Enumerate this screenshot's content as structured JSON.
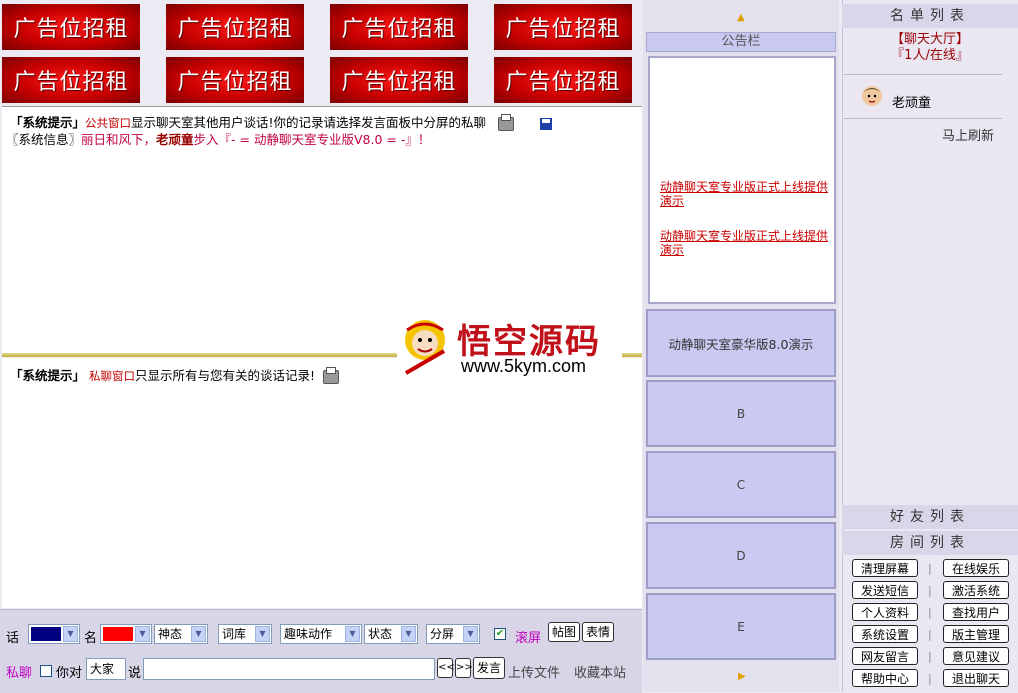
{
  "ads": {
    "label": "广告位招租",
    "count": 8
  },
  "public_window": {
    "line1": {
      "tag": "「系统提示」",
      "window": "公共窗口",
      "text": "显示聊天室其他用户谈话!你的记录请选择发言面板中分屏的私聊"
    },
    "line2": {
      "tag": "〖系统信息〗",
      "prefix": "丽日和风下，",
      "user": "老顽童",
      "mid": "步入『- = 动静聊天室专业版V8.0 = -』！"
    }
  },
  "private_window": {
    "tag": "「系统提示」",
    "window": "私聊窗口",
    "text": "只显示所有与您有关的谈话记录!"
  },
  "watermark": {
    "title": "悟空源码",
    "url": "www.5kym.com"
  },
  "notice": {
    "header": "公告栏",
    "links": [
      "动静聊天室专业版正式上线提供演示",
      "动静聊天室专业版正式上线提供演示"
    ]
  },
  "mid_boxes": [
    "动静聊天室豪华版8.0演示",
    "B",
    "C",
    "D",
    "E"
  ],
  "right": {
    "list_header": "名单列表",
    "room_name": "【聊天大厅】",
    "online": "『1人/在线』",
    "user": "老顽童",
    "refresh": "马上刷新",
    "friends_header": "好友列表",
    "rooms_header": "房间列表",
    "buttons_left": [
      "清理屏幕",
      "发送短信",
      "个人资料",
      "系统设置",
      "网友留言",
      "帮助中心"
    ],
    "buttons_right": [
      "在线娱乐",
      "激活系统",
      "查找用户",
      "版主管理",
      "意见建议",
      "退出聊天"
    ]
  },
  "toolbar": {
    "say_label": "话",
    "name_label": "名",
    "colors": {
      "say": "#000080",
      "name": "#ff0000"
    },
    "select_mood": "神态",
    "select_lexicon": "词库",
    "select_action": "趣味动作",
    "select_status": "状态",
    "select_split": "分屏",
    "scroll_label": "滚屏",
    "btn_sticker": "帖图",
    "btn_emotion": "表情",
    "private_label": "私聊",
    "you_to": "你对",
    "target": "大家",
    "say": "说",
    "prev": "<<",
    "next": ">>",
    "send": "发言",
    "upload": "上传文件",
    "bookmark": "收藏本站"
  }
}
